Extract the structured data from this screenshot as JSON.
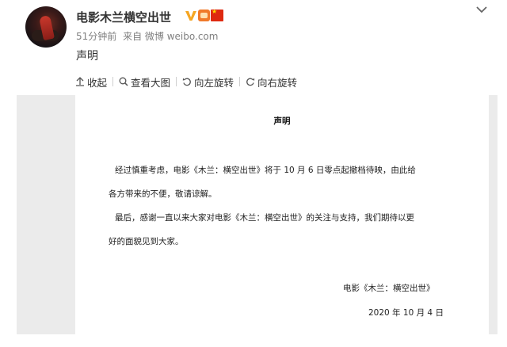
{
  "post": {
    "username": "电影木兰横空出世",
    "meta": {
      "time": "51分钟前",
      "source": "来自 微博 weibo.com"
    },
    "text": "声明"
  },
  "toolbar": {
    "collapse": "收起",
    "view_large": "查看大图",
    "rotate_left": "向左旋转",
    "rotate_right": "向右旋转"
  },
  "document": {
    "title": "声明",
    "paragraphs": [
      "经过慎重考虑，电影《木兰：横空出世》将于 10 月 6 日零点起撤档待映，由此给",
      "各方带来的不便，敬请谅解。",
      "最后，感谢一直以来大家对电影《木兰：横空出世》的关注与支持，我们期待以更",
      "好的面貌见到大家。"
    ],
    "signature": "电影《木兰：横空出世》",
    "date": "2020 年 10 月 4 日"
  },
  "colors": {
    "verified": "#f5a623",
    "flag": "#de2910",
    "text": "#333333",
    "meta": "#808080"
  },
  "icons": [
    "avatar",
    "verified-v-icon",
    "medal-icon",
    "china-flag-icon",
    "chevron-down-icon",
    "collapse-icon",
    "search-icon",
    "rotate-left-icon",
    "rotate-right-icon"
  ]
}
